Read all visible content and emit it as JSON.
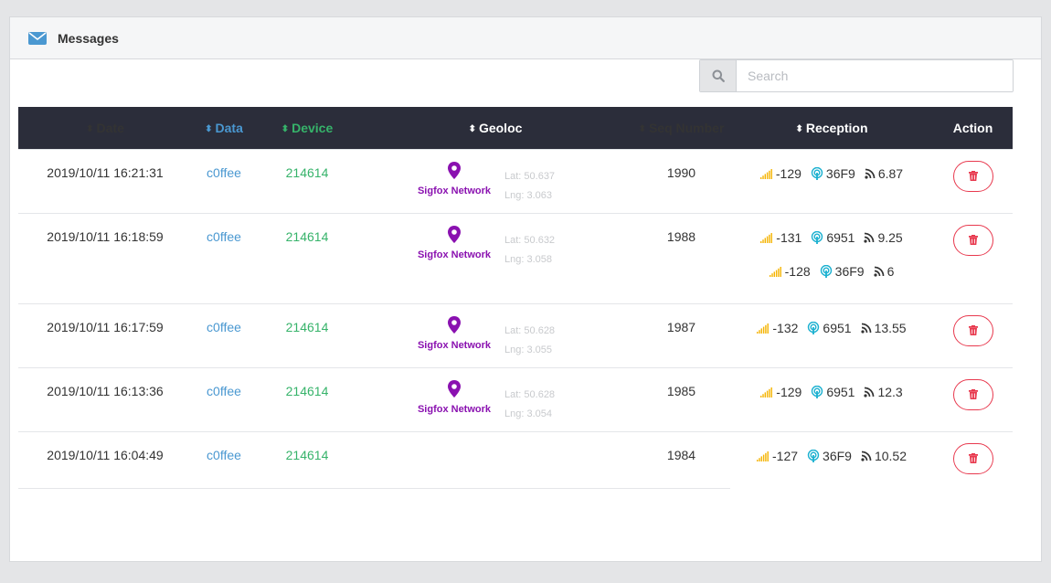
{
  "header": {
    "title": "Messages",
    "icon": "envelope-icon"
  },
  "search": {
    "placeholder": "Search",
    "icon": "search-icon"
  },
  "columns": [
    {
      "label": "Date",
      "sortable": true
    },
    {
      "label": "Data",
      "sortable": true
    },
    {
      "label": "Device",
      "sortable": true
    },
    {
      "label": "Geoloc",
      "sortable": true
    },
    {
      "label": "Seq Number",
      "sortable": true
    },
    {
      "label": "Reception",
      "sortable": true
    },
    {
      "label": "Action",
      "sortable": false
    }
  ],
  "rows": [
    {
      "date": "2019/10/11 16:21:31",
      "data": "c0ffee",
      "device": "214614",
      "geoloc": {
        "network": "Sigfox Network",
        "lat": "Lat: 50.637",
        "lng": "Lng: 3.063"
      },
      "seq": "1990",
      "reception": [
        {
          "rssi": "-129",
          "station": "36F9",
          "snr": "6.87"
        }
      ]
    },
    {
      "date": "2019/10/11 16:18:59",
      "data": "c0ffee",
      "device": "214614",
      "geoloc": {
        "network": "Sigfox Network",
        "lat": "Lat: 50.632",
        "lng": "Lng: 3.058"
      },
      "seq": "1988",
      "reception": [
        {
          "rssi": "-131",
          "station": "6951",
          "snr": "9.25"
        },
        {
          "rssi": "-128",
          "station": "36F9",
          "snr": "6"
        }
      ]
    },
    {
      "date": "2019/10/11 16:17:59",
      "data": "c0ffee",
      "device": "214614",
      "geoloc": {
        "network": "Sigfox Network",
        "lat": "Lat: 50.628",
        "lng": "Lng: 3.055"
      },
      "seq": "1987",
      "reception": [
        {
          "rssi": "-132",
          "station": "6951",
          "snr": "13.55"
        }
      ]
    },
    {
      "date": "2019/10/11 16:13:36",
      "data": "c0ffee",
      "device": "214614",
      "geoloc": {
        "network": "Sigfox Network",
        "lat": "Lat: 50.628",
        "lng": "Lng: 3.054"
      },
      "seq": "1985",
      "reception": [
        {
          "rssi": "-129",
          "station": "6951",
          "snr": "12.3"
        }
      ]
    },
    {
      "date": "2019/10/11 16:04:49",
      "data": "c0ffee",
      "device": "214614",
      "geoloc": null,
      "seq": "1984",
      "reception": [
        {
          "rssi": "-127",
          "station": "36F9",
          "snr": "10.52"
        }
      ]
    }
  ],
  "colors": {
    "header_bg": "#2b2d3a",
    "data_link": "#4a98d1",
    "device_link": "#36b36a",
    "network": "#8a11b0",
    "signal": "#f5b400",
    "station": "#1ab0d0",
    "delete": "#e8394e"
  }
}
